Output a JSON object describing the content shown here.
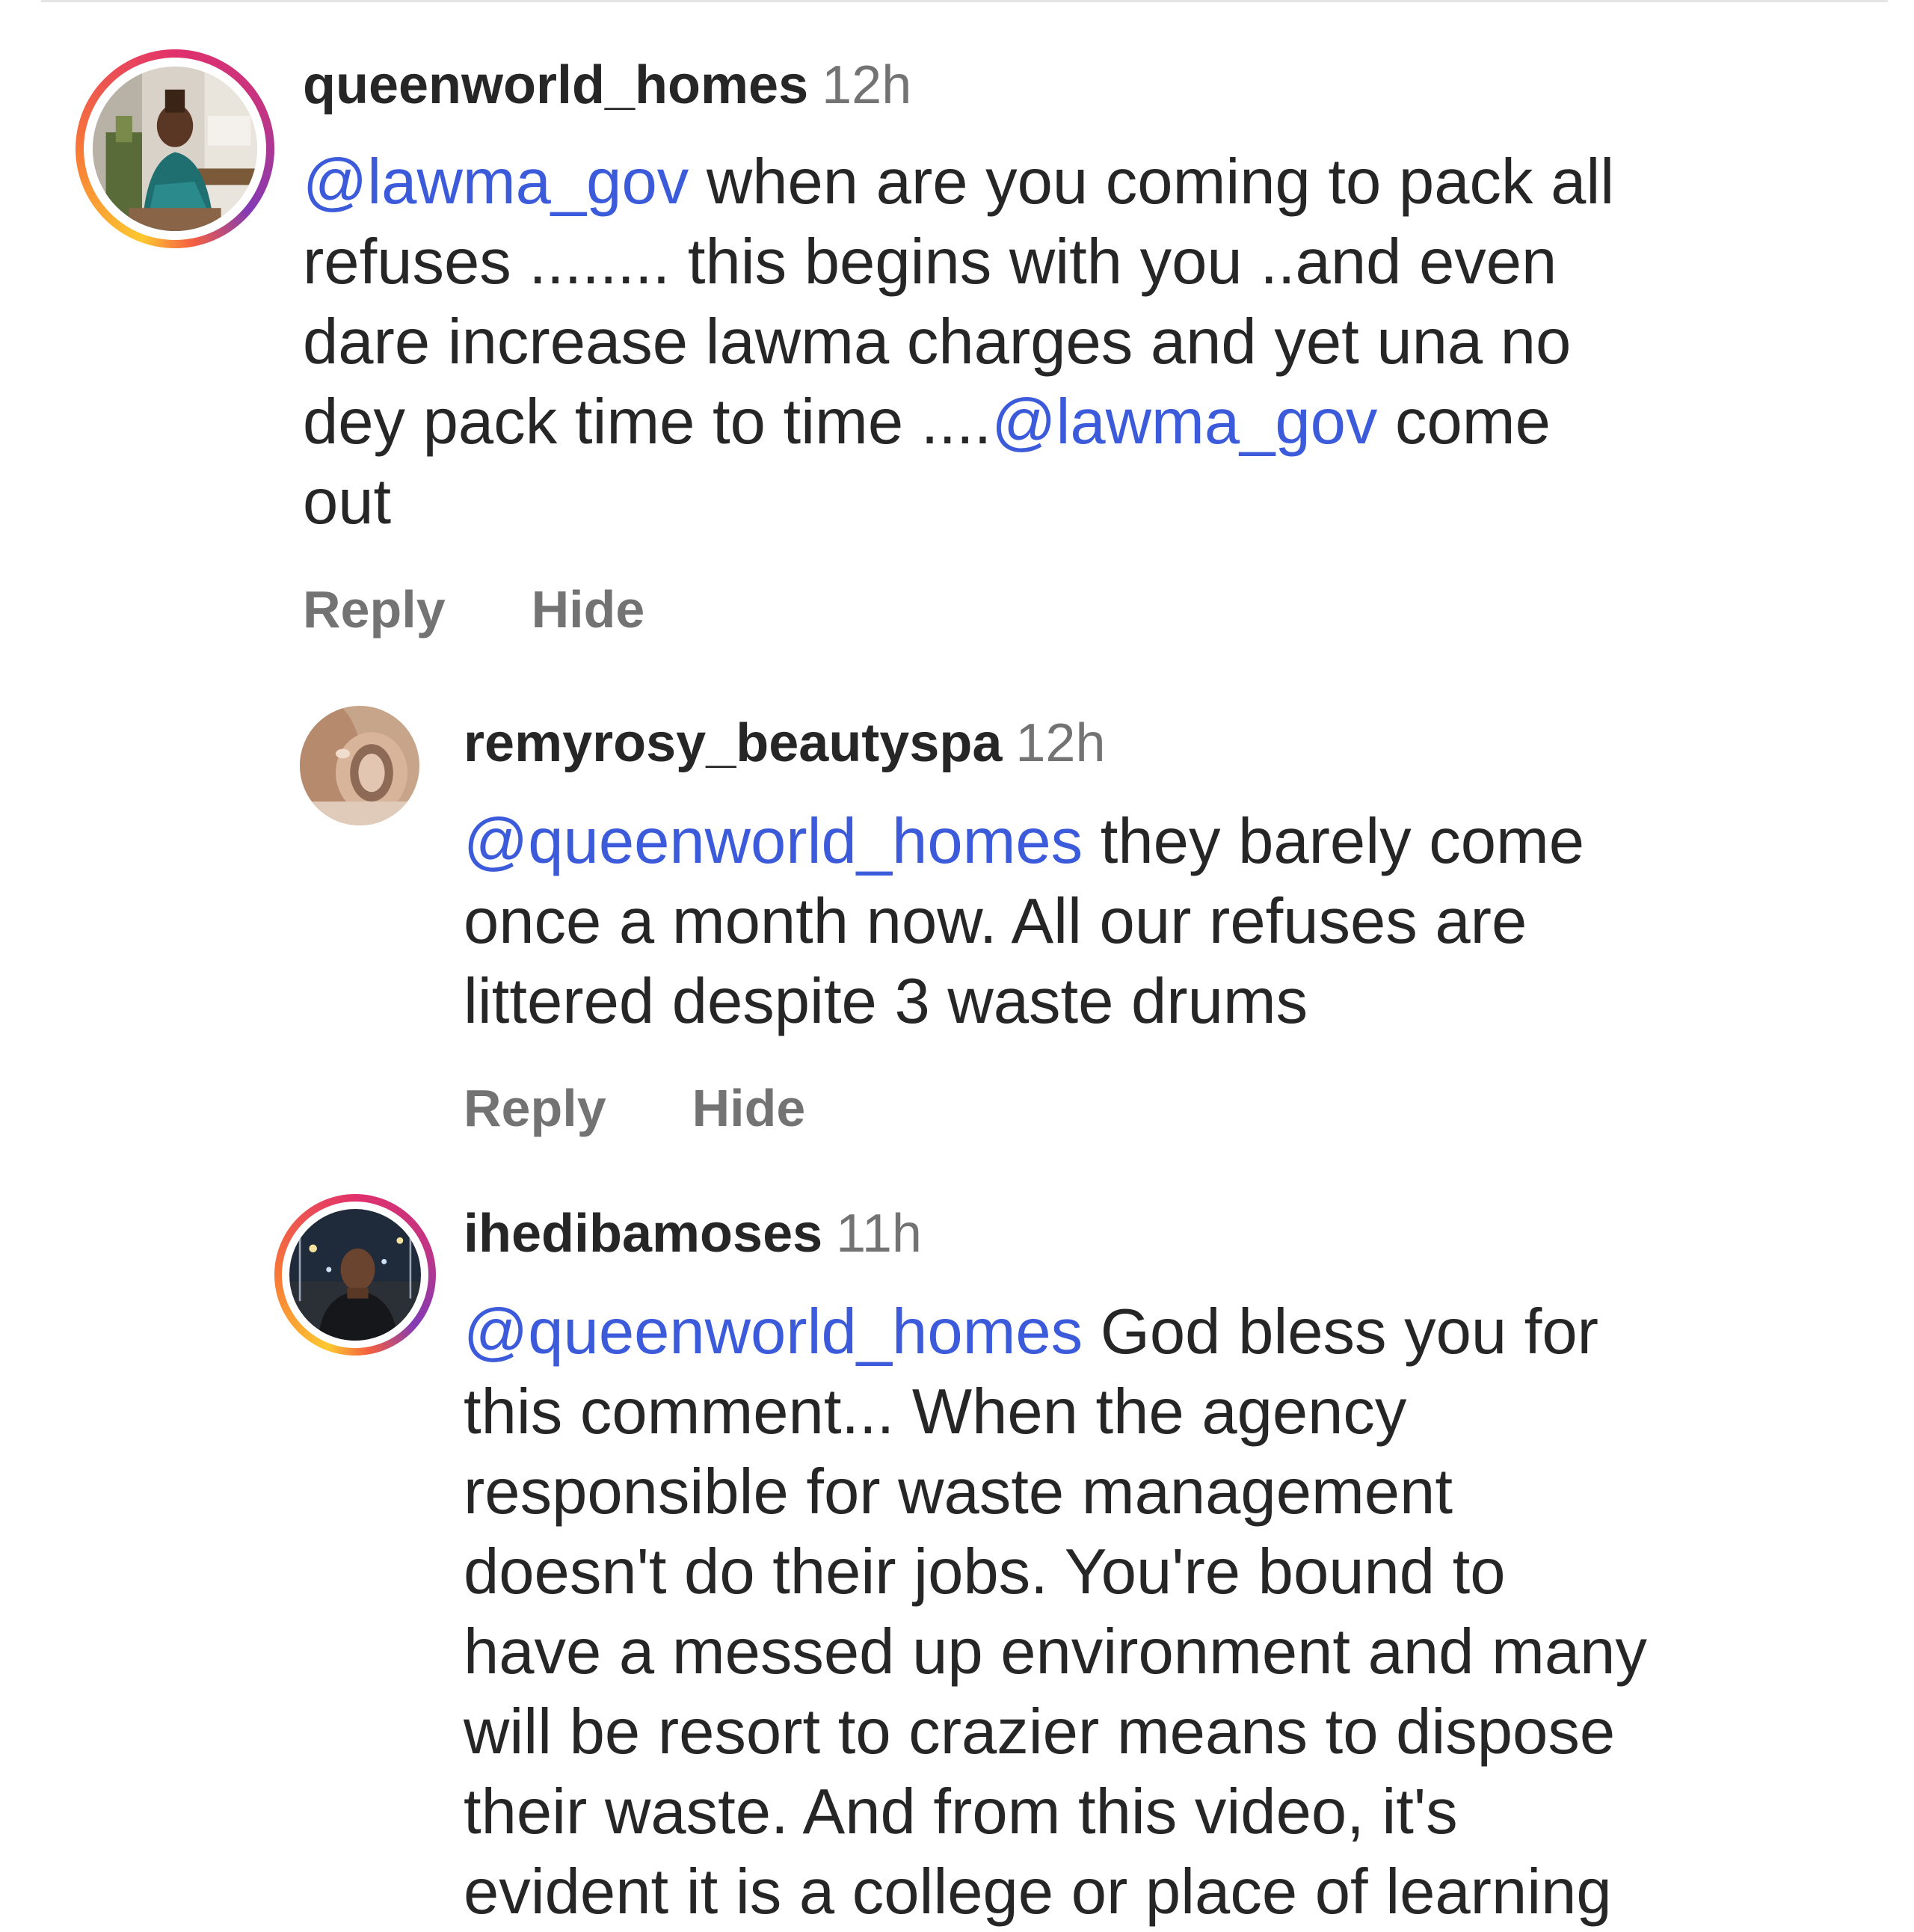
{
  "comments": [
    {
      "username": "queenworld_homes",
      "time": "12h",
      "lines": [
        [
          {
            "t": "@lawma_gov",
            "m": true
          },
          {
            "t": " when are you coming to pack all"
          }
        ],
        [
          {
            "t": "refuses ........ this begins with you ..and even"
          }
        ],
        [
          {
            "t": "dare increase lawma charges and yet una no"
          }
        ],
        [
          {
            "t": "dey pack time to time ...."
          },
          {
            "t": "@lawma_gov",
            "m": true
          },
          {
            "t": " come"
          }
        ],
        [
          {
            "t": "out"
          }
        ]
      ],
      "reply_label": "Reply",
      "hide_label": "Hide",
      "has_story_ring": true
    },
    {
      "username": "remyrosy_beautyspa",
      "time": "12h",
      "lines": [
        [
          {
            "t": "@queenworld_homes",
            "m": true
          },
          {
            "t": " they barely come"
          }
        ],
        [
          {
            "t": "once a month now. All our refuses are"
          }
        ],
        [
          {
            "t": "littered despite 3 waste drums"
          }
        ]
      ],
      "reply_label": "Reply",
      "hide_label": "Hide",
      "has_story_ring": false
    },
    {
      "username": "ihedibamoses",
      "time": "11h",
      "lines": [
        [
          {
            "t": "@queenworld_homes",
            "m": true
          },
          {
            "t": " God bless you for"
          }
        ],
        [
          {
            "t": "this comment... When the agency"
          }
        ],
        [
          {
            "t": "responsible for waste management"
          }
        ],
        [
          {
            "t": "doesn't do their jobs. You're bound to"
          }
        ],
        [
          {
            "t": "have a messed up environment and many"
          }
        ],
        [
          {
            "t": "will be resort to crazier means to dispose"
          }
        ],
        [
          {
            "t": "their waste. And from this video, it's"
          }
        ],
        [
          {
            "t": "evident it is a college or place of learning"
          }
        ]
      ],
      "has_story_ring": true
    }
  ],
  "colors": {
    "mention": "#3b5bdb",
    "text": "#262626",
    "muted": "#737373"
  }
}
